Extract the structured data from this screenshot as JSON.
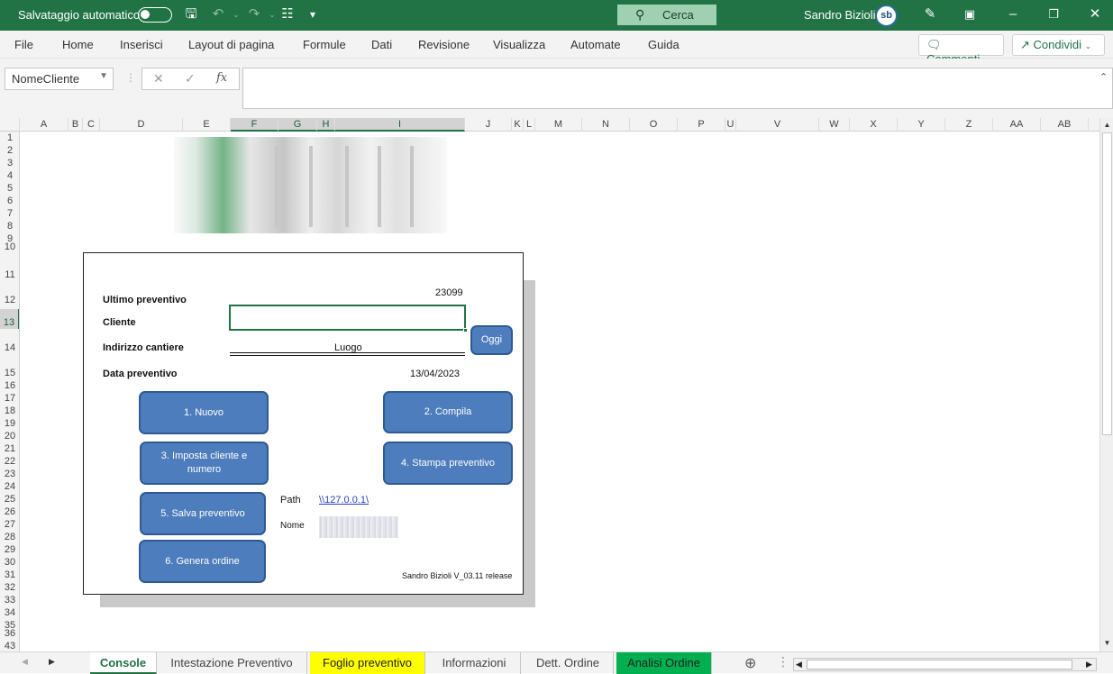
{
  "titlebar": {
    "autosave_label": "Salvataggio automatico",
    "search_label": "Cerca",
    "user_name": "Sandro Bizioli",
    "avatar_initials": "sb",
    "bg_color": "#217346"
  },
  "menubar": {
    "items": [
      "File",
      "Home",
      "Inserisci",
      "Layout di pagina",
      "Formule",
      "Dati",
      "Revisione",
      "Visualizza",
      "Automate",
      "Guida"
    ],
    "comments_label": "Commenti",
    "share_label": "Condividi"
  },
  "formula_bar": {
    "name_box": "NomeCliente",
    "formula_value": ""
  },
  "columns": [
    "A",
    "B",
    "C",
    "D",
    "E",
    "F",
    "G",
    "H",
    "I",
    "J",
    "K",
    "L",
    "M",
    "N",
    "O",
    "P",
    "U",
    "V",
    "W",
    "X",
    "Y",
    "Z",
    "AA",
    "AB"
  ],
  "rows": [
    "1",
    "2",
    "3",
    "4",
    "5",
    "6",
    "7",
    "8",
    "9",
    "10",
    "11",
    "12",
    "13",
    "14",
    "15",
    "16",
    "17",
    "18",
    "19",
    "20",
    "21",
    "22",
    "23",
    "24",
    "25",
    "26",
    "27",
    "28",
    "29",
    "30",
    "31",
    "32",
    "33",
    "34",
    "35",
    "36",
    "43"
  ],
  "form": {
    "ultimo_label": "Ultimo preventivo",
    "ultimo_value": "23099",
    "cliente_label": "Cliente",
    "cliente_value": "",
    "indirizzo_label": "Indirizzo cantiere",
    "indirizzo_value": "Luogo",
    "data_label": "Data preventivo",
    "data_value": "13/04/2023",
    "oggi_button": "Oggi",
    "btn_nuovo": "1. Nuovo",
    "btn_compila": "2. Compila",
    "btn_imposta": "3. Imposta cliente e numero",
    "btn_stampa": "4. Stampa preventivo",
    "btn_salva": "5. Salva preventivo",
    "btn_genera": "6. Genera ordine",
    "path_label": "Path",
    "path_value": "\\\\127.0.0.1\\",
    "nome_label": "Nome",
    "footer": "Sandro Bizioli V_03.11 release"
  },
  "sheet_tabs": [
    {
      "label": "Console",
      "active": true,
      "color": ""
    },
    {
      "label": "Intestazione Preventivo",
      "active": false,
      "color": ""
    },
    {
      "label": "Foglio preventivo",
      "active": false,
      "color": "#ffff00"
    },
    {
      "label": "Informazioni",
      "active": false,
      "color": ""
    },
    {
      "label": "Dett. Ordine",
      "active": false,
      "color": ""
    },
    {
      "label": "Analisi Ordine",
      "active": false,
      "color": "#00b050"
    }
  ]
}
